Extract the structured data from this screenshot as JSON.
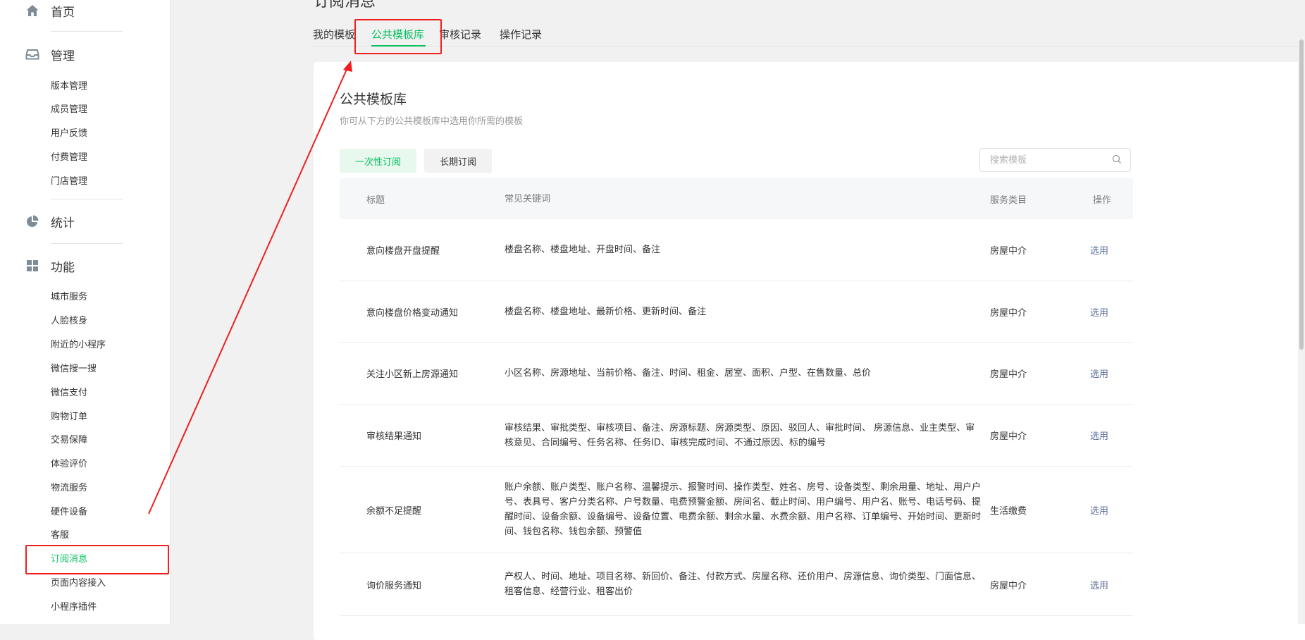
{
  "sidebar": {
    "sections": [
      {
        "label": "首页",
        "icon": "home-icon"
      },
      {
        "label": "管理",
        "icon": "inbox-icon"
      },
      {
        "label": "统计",
        "icon": "pie-chart-icon"
      },
      {
        "label": "功能",
        "icon": "grid-icon"
      }
    ],
    "manage_items": [
      "版本管理",
      "成员管理",
      "用户反馈",
      "付费管理",
      "门店管理"
    ],
    "feature_items": [
      "城市服务",
      "人脸核身",
      "附近的小程序",
      "微信搜一搜",
      "微信支付",
      "购物订单",
      "交易保障",
      "体验评价",
      "物流服务",
      "硬件设备",
      "客服",
      "订阅消息",
      "页面内容接入",
      "小程序插件"
    ],
    "active_item": "订阅消息"
  },
  "header": {
    "title": "订阅消息",
    "tabs": [
      "我的模板",
      "公共模板库",
      "审核记录",
      "操作记录"
    ],
    "active_tab": "公共模板库"
  },
  "card": {
    "title": "公共模板库",
    "subtitle": "你可从下方的公共模板库中选用你所需的模板",
    "subtabs": [
      "一次性订阅",
      "长期订阅"
    ],
    "search_placeholder": "搜索模板"
  },
  "table": {
    "headers": [
      "标题",
      "常见关键词",
      "服务类目",
      "操作"
    ],
    "rows": [
      {
        "title": "意向楼盘开盘提醒",
        "keywords": "楼盘名称、楼盘地址、开盘时间、备注",
        "category": "房屋中介",
        "action": "选用"
      },
      {
        "title": "意向楼盘价格变动通知",
        "keywords": "楼盘名称、楼盘地址、最新价格、更新时间、备注",
        "category": "房屋中介",
        "action": "选用"
      },
      {
        "title": "关注小区新上房源通知",
        "keywords": "小区名称、房源地址、当前价格、备注、时间、租金、居室、面积、户型、在售数量、总价",
        "category": "房屋中介",
        "action": "选用"
      },
      {
        "title": "审核结果通知",
        "keywords": "审核结果、审批类型、审核项目、备注、房源标题、房源类型、原因、驳回人、审批时间、 房源信息、业主类型、审核意见、合同编号、任务名称、任务ID、审核完成时间、不通过原因、标的编号",
        "category": "房屋中介",
        "action": "选用"
      },
      {
        "title": "余额不足提醒",
        "keywords": "账户余额、账户类型、账户名称、温馨提示、报警时间、操作类型、姓名、房号、设备类型、剩余用量、地址、用户户号、表具号、客户分类名称、户号数量、电费预警金额、房间名、截止时间、用户编号、用户名、账号、电话号码、提醒时间、设备余额、设备编号、设备位置、电费余额、剩余水量、水费余额、用户名称、订单编号、开始时间、更新时间、钱包名称、钱包余额、预警值",
        "category": "生活缴费",
        "action": "选用"
      },
      {
        "title": "询价服务通知",
        "keywords": "产权人、时间、地址、项目名称、新回价、备注、付款方式、房屋名称、还价用户、房源信息、询价类型、门面信息、租客信息、经营行业、租客出价",
        "category": "房屋中介",
        "action": "选用"
      }
    ]
  },
  "colors": {
    "accent": "#07c160",
    "link": "#576b95",
    "highlight": "#ef1f1f"
  }
}
